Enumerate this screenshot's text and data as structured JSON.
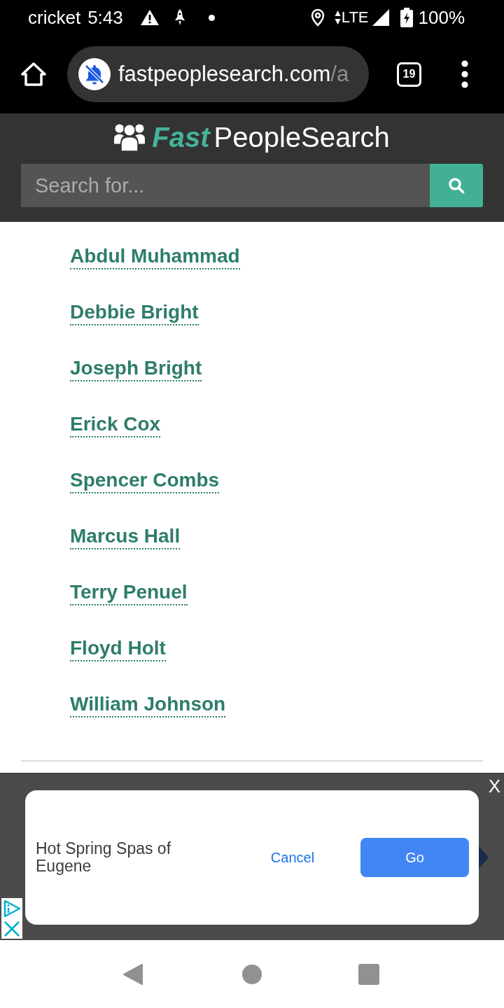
{
  "status_bar": {
    "carrier": "cricket",
    "time": "5:43",
    "network": "LTE",
    "battery": "100%"
  },
  "browser_bar": {
    "url_domain": "fastpeoplesearch.com",
    "url_path": "/a",
    "tab_count": "19"
  },
  "site_header": {
    "logo": {
      "accent": "Fast",
      "text": "PeopleSearch"
    },
    "search": {
      "placeholder": "Search for..."
    }
  },
  "names": [
    "Abdul Muhammad",
    "Debbie Bright",
    "Joseph Bright",
    "Erick Cox",
    "Spencer Combs",
    "Marcus Hall",
    "Terry Penuel",
    "Floyd Holt",
    "William Johnson"
  ],
  "ad": {
    "close": "X",
    "title": "Hot Spring Spas of Eugene",
    "cancel": "Cancel",
    "go": "Go"
  }
}
